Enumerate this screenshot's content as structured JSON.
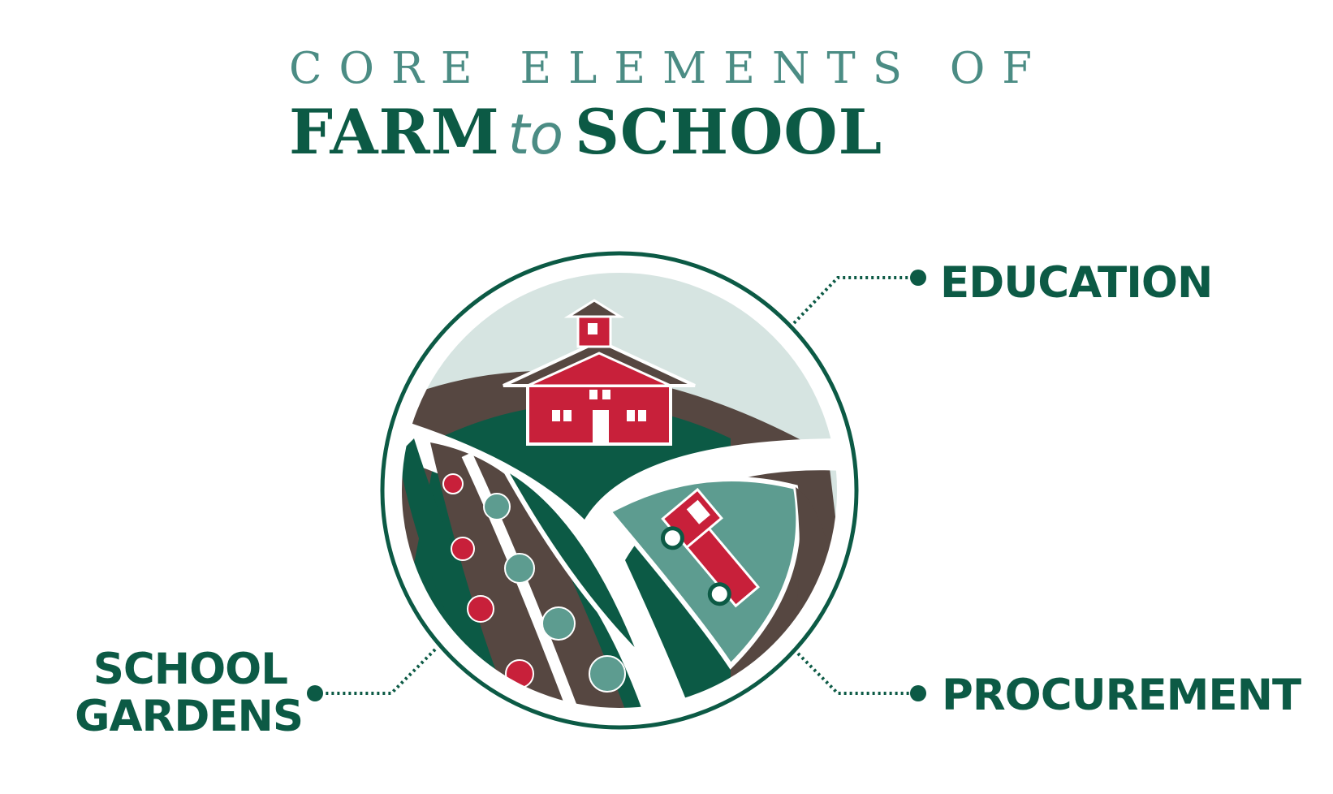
{
  "title": {
    "top": "CORE ELEMENTS OF",
    "farm": "FARM",
    "to": "to",
    "school": "SCHOOL"
  },
  "labels": {
    "education": "EDUCATION",
    "procurement": "PROCUREMENT",
    "gardens_line1": "SCHOOL",
    "gardens_line2": "GARDENS"
  },
  "colors": {
    "dark_green": "#0c5a45",
    "teal": "#4b8c84",
    "red": "#c8203a",
    "brown": "#564741",
    "sky": "#d6e4e1",
    "sage": "#5d9c90"
  }
}
